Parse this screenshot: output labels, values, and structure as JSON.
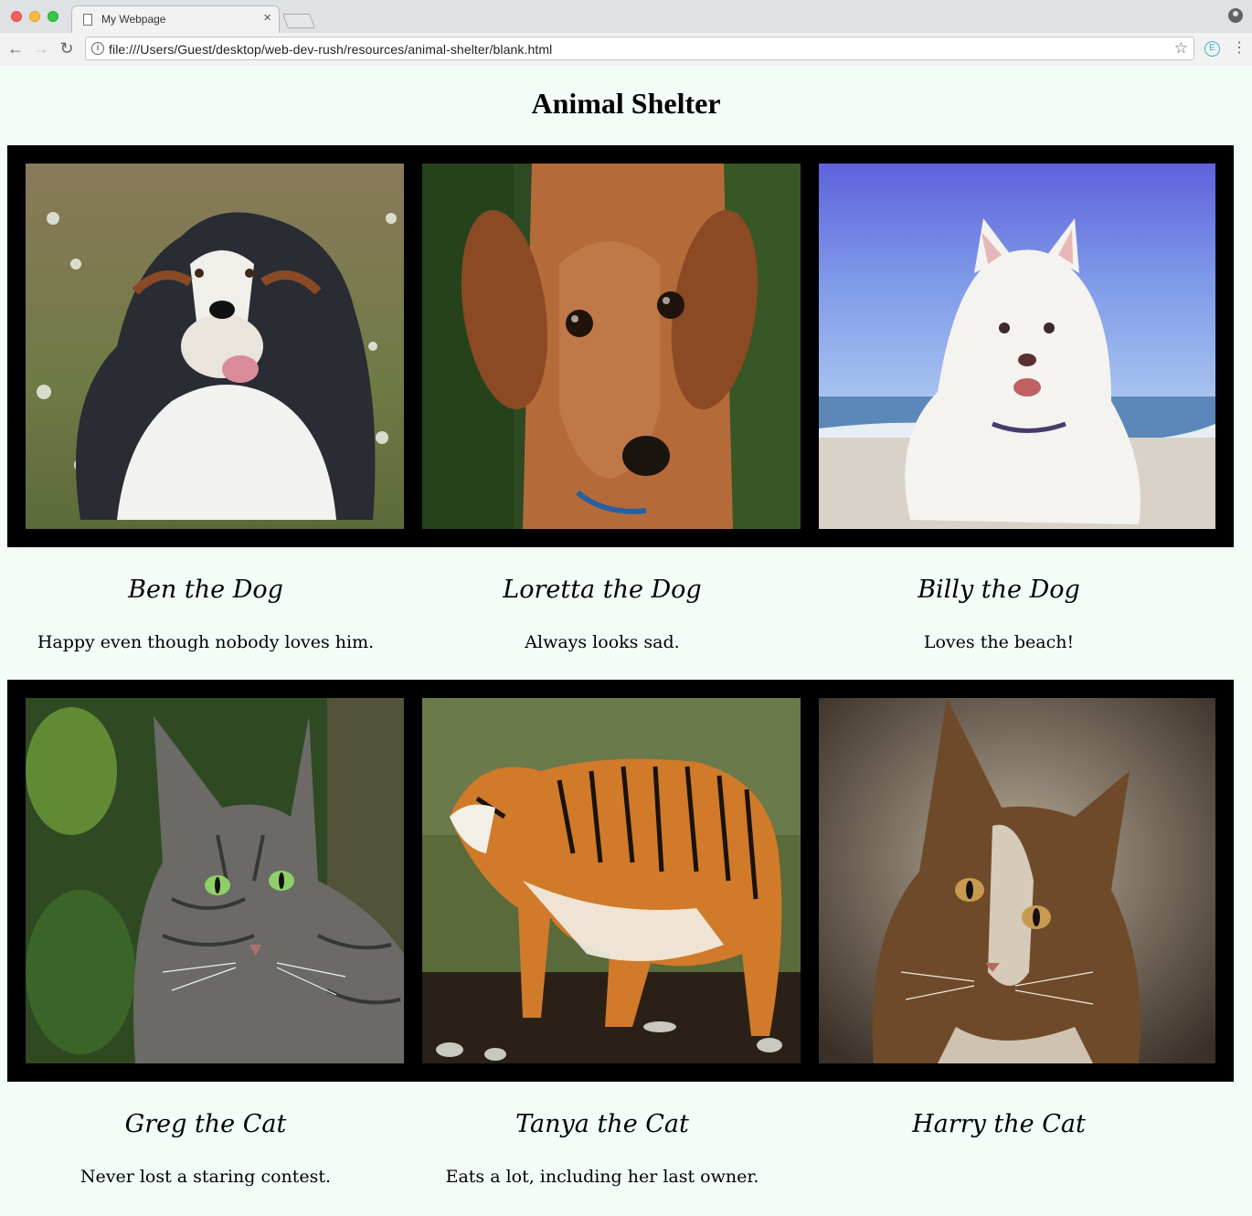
{
  "browser": {
    "tab_title": "My Webpage",
    "tab_close": "×",
    "url": "file:///Users/Guest/desktop/web-dev-rush/resources/animal-shelter/blank.html",
    "extension_letter": "E"
  },
  "page": {
    "title": "Animal Shelter"
  },
  "animals": [
    {
      "name": "Ben the Dog",
      "description": "Happy even though nobody loves him."
    },
    {
      "name": "Loretta the Dog",
      "description": "Always looks sad."
    },
    {
      "name": "Billy the Dog",
      "description": "Loves the beach!"
    },
    {
      "name": "Greg the Cat",
      "description": "Never lost a staring contest."
    },
    {
      "name": "Tanya the Cat",
      "description": "Eats a lot, including her last owner."
    },
    {
      "name": "Harry the Cat",
      "description": ""
    }
  ]
}
